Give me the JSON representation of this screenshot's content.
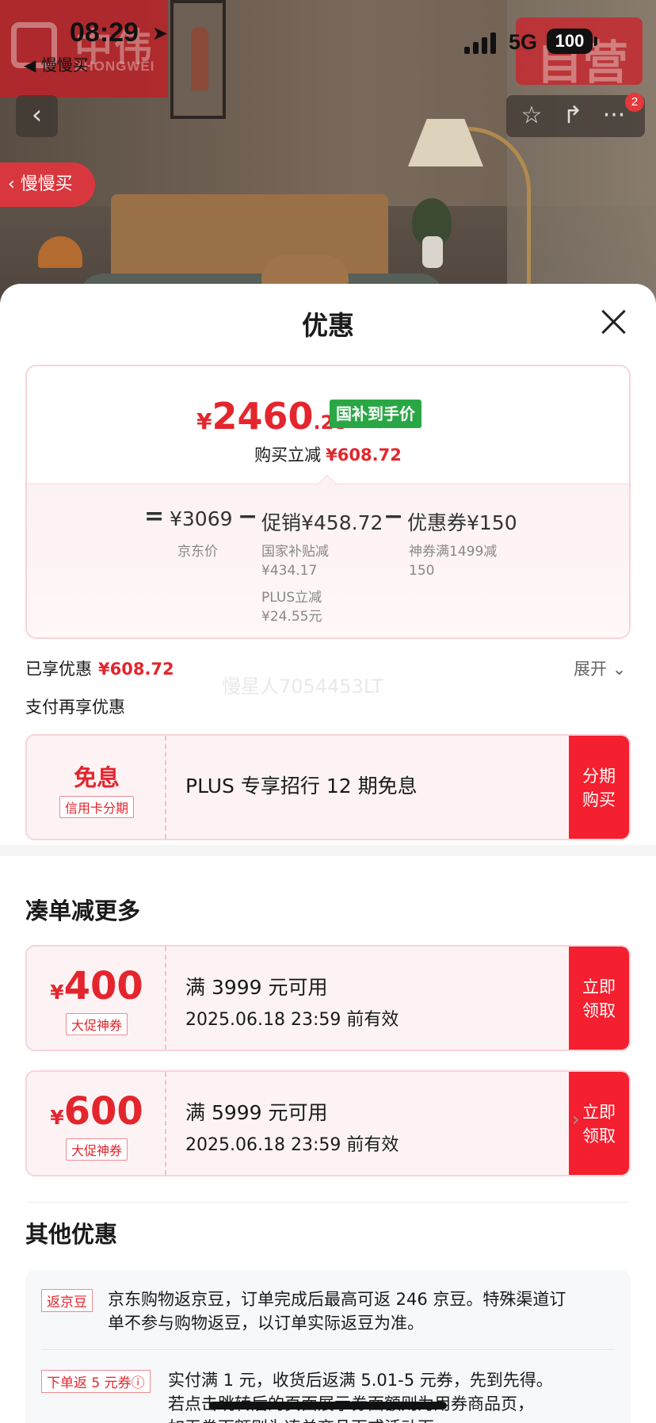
{
  "status_bar": {
    "time": "08:29",
    "back_app": "◀ 慢慢买",
    "network": "5G",
    "battery": "100"
  },
  "brand": {
    "left_text": "中伟",
    "left_sub": "ZHONGWEI",
    "right_text": "自营"
  },
  "nav": {
    "cart_badge": "2",
    "slow_buy_label": "慢慢买"
  },
  "sheet": {
    "title": "优惠",
    "price": {
      "symbol": "¥",
      "integer": "2460",
      "decimal": ".28",
      "tag": "国补到手价",
      "reduce_label": "购买立减",
      "reduce_value": "¥608.72"
    },
    "formula": {
      "eq": "=",
      "jd_price": "¥3069",
      "jd_price_label": "京东价",
      "minus1": "−",
      "promo": "促销¥458.72",
      "promo_sub1_label": "国家补贴减",
      "promo_sub1_value": "¥434.17",
      "promo_sub2_label": "PLUS立减",
      "promo_sub2_value": "¥24.55元",
      "minus2": "−",
      "coupon": "优惠券¥150",
      "coupon_sub_line1": "神券满1499减",
      "coupon_sub_line2": "150"
    },
    "enjoyed_label": "已享优惠",
    "enjoyed_value": "¥608.72",
    "expand_label": "展开",
    "watermark": "慢星人7054453LT",
    "pay_more_label": "支付再享优惠",
    "installment": {
      "title": "免息",
      "tag": "信用卡分期",
      "text": "PLUS 专享招行 12 期免息",
      "button_line1": "分期",
      "button_line2": "购买"
    },
    "more_title": "凑单减更多",
    "coupons": [
      {
        "symbol": "¥",
        "amount": "400",
        "tag": "大促神券",
        "condition": "满 3999 元可用",
        "validity": "2025.06.18 23:59 前有效",
        "button_line1": "立即",
        "button_line2": "领取"
      },
      {
        "symbol": "¥",
        "amount": "600",
        "tag": "大促神券",
        "condition": "满 5999 元可用",
        "validity": "2025.06.18 23:59 前有效",
        "button_line1": "立即",
        "button_line2": "领取"
      }
    ],
    "other_title": "其他优惠",
    "other_items": [
      {
        "tag": "返京豆",
        "line1": "京东购物返京豆，订单完成后最高可返 246 京豆。特殊渠道订",
        "line2": "单不参与购物返豆，以订单实际返豆为准。"
      },
      {
        "tag": "下单返 5 元券ⓘ",
        "line1": "实付满 1 元，收货后返满 5.01-5 元券，先到先得。",
        "line2": "若点击跳转后的页面展示券面额则为用券商品页，",
        "line3": "如无券面额则为凑单商品页或活动页。"
      }
    ]
  }
}
